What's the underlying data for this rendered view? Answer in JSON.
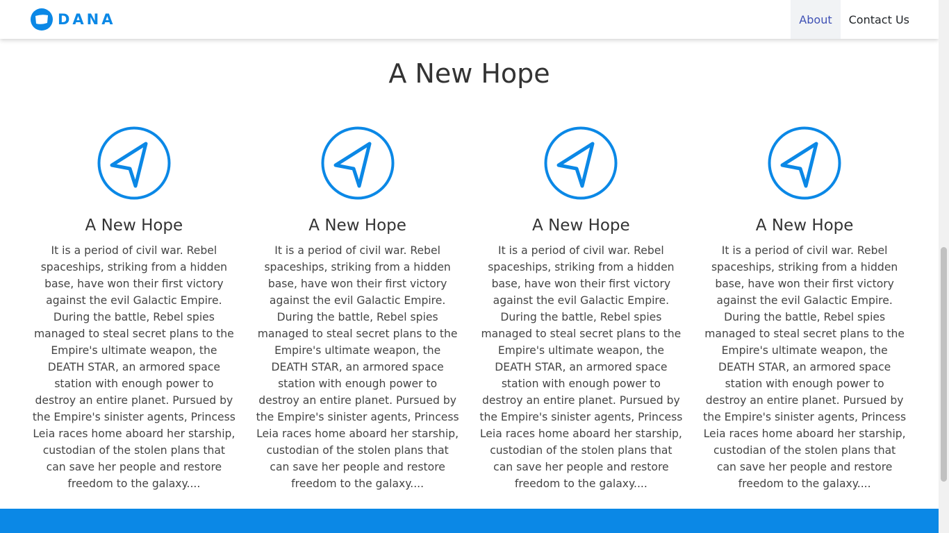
{
  "header": {
    "logo_text": "DANA",
    "nav": [
      {
        "label": "About",
        "active": true
      },
      {
        "label": "Contact Us",
        "active": false
      }
    ]
  },
  "main": {
    "title": "A New Hope",
    "icon": "navigation-arrow-icon",
    "accent_color": "#0b88e6",
    "cards": [
      {
        "title": "A New Hope",
        "text": "It is a period of civil war. Rebel spaceships, striking from a hidden base, have won their first victory against the evil Galactic Empire. During the battle, Rebel spies managed to steal secret plans to the Empire's ultimate weapon, the DEATH STAR, an armored space station with enough power to destroy an entire planet. Pursued by the Empire's sinister agents, Princess Leia races home aboard her starship, custodian of the stolen plans that can save her people and restore freedom to the galaxy...."
      },
      {
        "title": "A New Hope",
        "text": "It is a period of civil war. Rebel spaceships, striking from a hidden base, have won their first victory against the evil Galactic Empire. During the battle, Rebel spies managed to steal secret plans to the Empire's ultimate weapon, the DEATH STAR, an armored space station with enough power to destroy an entire planet. Pursued by the Empire's sinister agents, Princess Leia races home aboard her starship, custodian of the stolen plans that can save her people and restore freedom to the galaxy...."
      },
      {
        "title": "A New Hope",
        "text": "It is a period of civil war. Rebel spaceships, striking from a hidden base, have won their first victory against the evil Galactic Empire. During the battle, Rebel spies managed to steal secret plans to the Empire's ultimate weapon, the DEATH STAR, an armored space station with enough power to destroy an entire planet. Pursued by the Empire's sinister agents, Princess Leia races home aboard her starship, custodian of the stolen plans that can save her people and restore freedom to the galaxy...."
      },
      {
        "title": "A New Hope",
        "text": "It is a period of civil war. Rebel spaceships, striking from a hidden base, have won their first victory against the evil Galactic Empire. During the battle, Rebel spies managed to steal secret plans to the Empire's ultimate weapon, the DEATH STAR, an armored space station with enough power to destroy an entire planet. Pursued by the Empire's sinister agents, Princess Leia races home aboard her starship, custodian of the stolen plans that can save her people and restore freedom to the galaxy...."
      }
    ]
  },
  "footer": {
    "band_color": "#0b88e6"
  }
}
